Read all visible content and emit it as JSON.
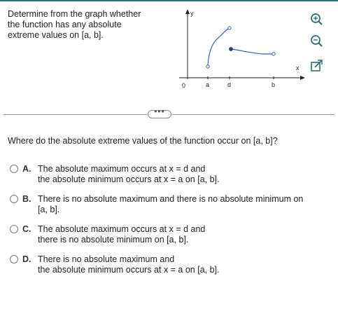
{
  "prompt": {
    "lines": [
      "Determine from the graph whether",
      "the function has any absolute",
      "extreme values on [a, b]."
    ]
  },
  "graph": {
    "y_label": "y",
    "x_label": "x",
    "origin_label": "0",
    "tick_labels": [
      "a",
      "d",
      "b"
    ],
    "curve_color": "#3a62b3"
  },
  "toolbar": {
    "zoom_in_icon": "magnifier-plus-icon",
    "zoom_out_icon": "magnifier-minus-icon",
    "popout_icon": "external-popout-icon"
  },
  "more_button": {
    "label": "•••"
  },
  "question": "Where do the absolute extreme values of the function occur on [a, b]?",
  "options": [
    {
      "letter": "A.",
      "lines": [
        "The absolute maximum occurs at x = d and",
        "the absolute minimum occurs at x = a on [a, b]."
      ]
    },
    {
      "letter": "B.",
      "lines": [
        "There is no absolute maximum and there is no absolute minimum on",
        "[a, b]."
      ]
    },
    {
      "letter": "C.",
      "lines": [
        "The absolute maximum occurs at x = d and",
        "there is no absolute minimum on [a, b]."
      ]
    },
    {
      "letter": "D.",
      "lines": [
        "There is no absolute maximum and",
        "the absolute minimum occurs at x = a on [a, b]."
      ]
    }
  ]
}
